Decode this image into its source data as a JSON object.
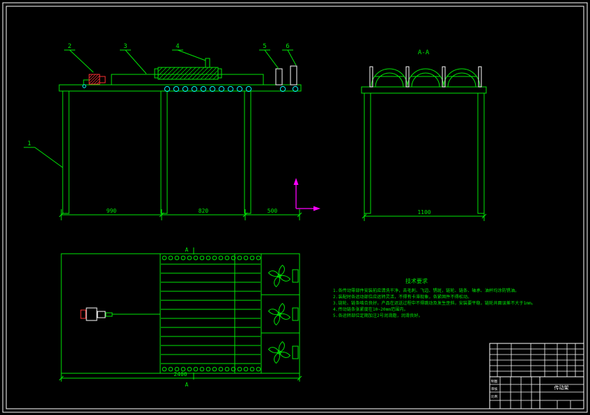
{
  "colors": {
    "background": "#000000",
    "line_green": "#00e606",
    "detail_cyan": "#00ffff",
    "frame_white": "#ffffff",
    "part_red": "#ff3232",
    "ucs_magenta": "#ff00ff"
  },
  "views": {
    "front": {
      "balloons": [
        "1",
        "2",
        "3",
        "4",
        "5",
        "6"
      ],
      "dims": [
        "990",
        "820",
        "500"
      ]
    },
    "section": {
      "label": "A-A",
      "dim": "1100"
    },
    "plan": {
      "mark": "A",
      "dim": "2400"
    }
  },
  "tech_requirements": {
    "title": "技术要求",
    "lines": [
      "1.各传动零部件安装前应清洗干净，去毛刺、飞边、锈斑，链轮、链条、轴承、油杯均涂防锈油。",
      "2.装配时各运动部位应运转灵活，不得有卡滞现象，各紧固件不得松动。",
      "3.链轮、链条啮合良好，产品在运送过程中不得跳动及发生歪斜，安装要平稳，链轮共面误差不大于1mm。",
      "4.传动链条张紧度在10~20mm范围内。",
      "5.各运转部位定期加注2号润滑脂，润滑良好。"
    ]
  },
  "title_block": {
    "title": "传动架",
    "labels": [
      "制图",
      "审核",
      "比例"
    ]
  }
}
